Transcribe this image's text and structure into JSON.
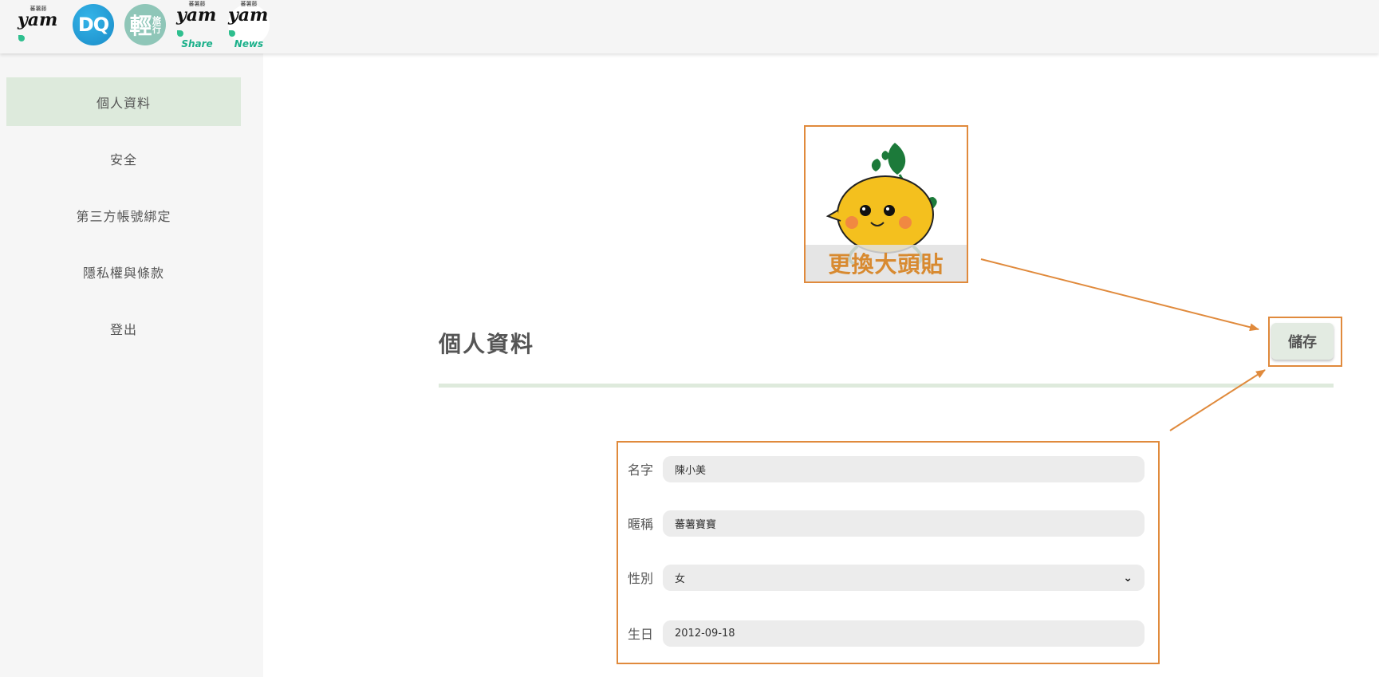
{
  "brands": [
    {
      "id": "yam",
      "label": "yam",
      "mini": "蕃薯藤"
    },
    {
      "id": "dq",
      "label": "DQ"
    },
    {
      "id": "qing",
      "label": "輕",
      "sub": "旅行"
    },
    {
      "id": "share",
      "label": "yam",
      "sub": "Share",
      "mini": "蕃薯藤"
    },
    {
      "id": "news",
      "label": "yam",
      "sub": "News",
      "mini": "蕃薯藤"
    }
  ],
  "sidebar": {
    "items": [
      {
        "label": "個人資料",
        "active": true
      },
      {
        "label": "安全"
      },
      {
        "label": "第三方帳號綁定"
      },
      {
        "label": "隱私權與條款"
      },
      {
        "label": "登出"
      }
    ]
  },
  "avatar": {
    "caption": "更換大頭貼"
  },
  "main": {
    "title": "個人資料",
    "save_label": "儲存"
  },
  "form": {
    "name_label": "名字",
    "name_value": "陳小美",
    "nickname_label": "暱稱",
    "nickname_value": "蕃薯寶寶",
    "gender_label": "性別",
    "gender_value": "女",
    "birthday_label": "生日",
    "birthday_value": "2012-09-18"
  },
  "colors": {
    "accent_orange": "#e08a3c",
    "active_green": "#ddeadc",
    "caption_orange": "#d88a30"
  }
}
